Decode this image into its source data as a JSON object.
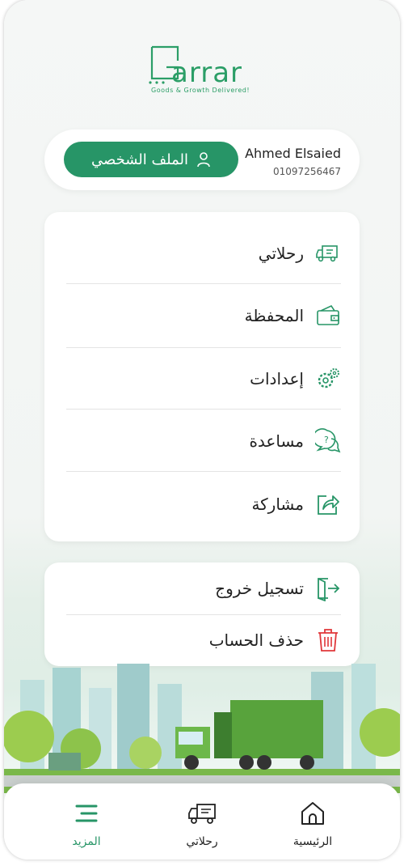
{
  "brand": {
    "logo_text": "arrar",
    "tagline": "Goods & Growth Delivered!",
    "color": "#2b9e67"
  },
  "profile": {
    "name": "Ahmed Elsaied",
    "phone": "01097256467",
    "button_label": "الملف الشخصي",
    "button_icon": "user-icon"
  },
  "menu": {
    "items": [
      {
        "label": "رحلاتي",
        "icon": "truck-icon"
      },
      {
        "label": "المحفظة",
        "icon": "wallet-icon"
      },
      {
        "label": "إعدادات",
        "icon": "gear-icon"
      },
      {
        "label": "مساعدة",
        "icon": "help-chat-icon"
      },
      {
        "label": "مشاركة",
        "icon": "share-icon"
      }
    ]
  },
  "account": {
    "logout_label": "تسجيل خروج",
    "delete_label": "حذف الحساب",
    "delete_color": "#e0373a"
  },
  "bottom_nav": {
    "items": [
      {
        "label": "الرئيسية",
        "icon": "home-icon",
        "active": false
      },
      {
        "label": "رحلاتي",
        "icon": "truck-icon",
        "active": false
      },
      {
        "label": "المزيد",
        "icon": "menu-icon",
        "active": true
      }
    ]
  },
  "colors": {
    "accent": "#279567",
    "text": "#222222"
  }
}
